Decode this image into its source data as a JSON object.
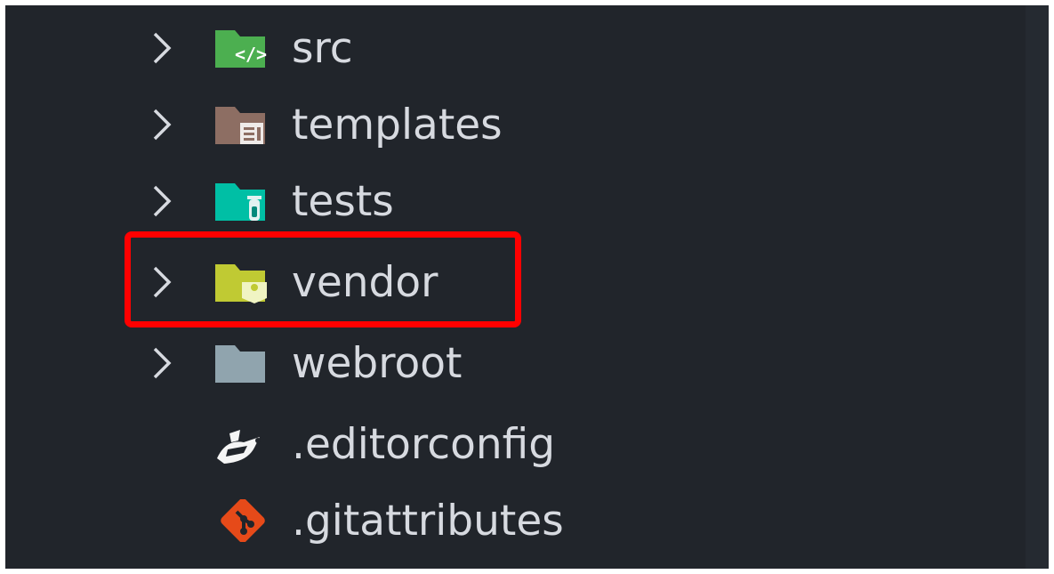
{
  "explorer": {
    "items": [
      {
        "label": "src",
        "kind": "folder",
        "icon": "folder-src-icon",
        "color": "#4caf50",
        "expanded": false
      },
      {
        "label": "templates",
        "kind": "folder",
        "icon": "folder-templates-icon",
        "color": "#8d6e63",
        "expanded": false
      },
      {
        "label": "tests",
        "kind": "folder",
        "icon": "folder-test-icon",
        "color": "#00bfa5",
        "expanded": false
      },
      {
        "label": "vendor",
        "kind": "folder",
        "icon": "folder-vendor-icon",
        "color": "#c0ca33",
        "expanded": false,
        "highlighted": true
      },
      {
        "label": "webroot",
        "kind": "folder",
        "icon": "folder-icon",
        "color": "#90a4ae",
        "expanded": false
      },
      {
        "label": ".editorconfig",
        "kind": "file",
        "icon": "editorconfig-icon",
        "color": "#f5f5f5"
      },
      {
        "label": ".gitattributes",
        "kind": "file",
        "icon": "git-icon",
        "color": "#e64a19"
      }
    ]
  },
  "annotation": {
    "highlight_color": "#ff0000"
  }
}
